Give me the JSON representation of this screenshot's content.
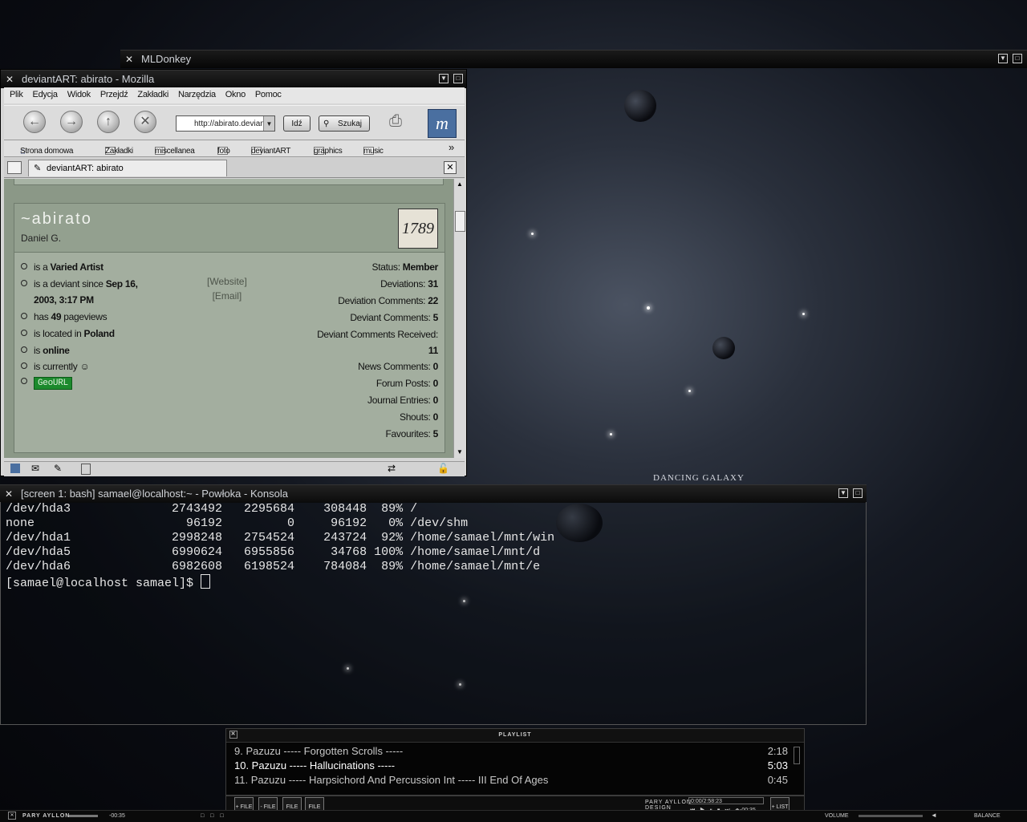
{
  "wallpaper": {
    "caption": "DANCING GALAXY"
  },
  "mldonkey": {
    "title": "MLDonkey"
  },
  "mozilla": {
    "title": "deviantART: abirato - Mozilla",
    "menu": [
      "Plik",
      "Edycja",
      "Widok",
      "Przejdź",
      "Zakładki",
      "Narzędzia",
      "Okno",
      "Pomoc"
    ],
    "url": "http://abirato.deviantart.com",
    "go_label": "Idź",
    "search_label": "Szukaj",
    "bookmarks": [
      "Strona domowa",
      "Zakładki",
      "miscellanea",
      "foto",
      "deviantART",
      "graphics",
      "music"
    ],
    "bookmarks_more": "»",
    "tab_title": "deviantART: abirato",
    "profile": {
      "username": "~abirato",
      "realname": "Daniel G.",
      "avatar_text": "1789",
      "info": [
        {
          "pre": "is a ",
          "bold": "Varied Artist",
          "post": ""
        },
        {
          "pre": "is a deviant since ",
          "bold": "Sep 16,",
          "post": ""
        },
        {
          "pre": "",
          "bold": "2003, 3:17 PM",
          "post": ""
        },
        {
          "pre": "has ",
          "bold": "49",
          "post": " pageviews"
        },
        {
          "pre": "is located in ",
          "bold": "Poland",
          "post": ""
        },
        {
          "pre": "is ",
          "bold": "online",
          "post": ""
        },
        {
          "pre": "is currently ",
          "bold": "",
          "post": ""
        }
      ],
      "geourl": "GeoURL",
      "website": "[Website]",
      "email": "[Email]",
      "stats": [
        {
          "label": "Status: ",
          "value": "Member"
        },
        {
          "label": "Deviations: ",
          "value": "31"
        },
        {
          "label": "Deviation Comments: ",
          "value": "22"
        },
        {
          "label": "Deviant Comments: ",
          "value": "5"
        },
        {
          "label": "Deviant Comments Received:",
          "value": ""
        },
        {
          "label": "",
          "value": "11"
        },
        {
          "label": "News Comments: ",
          "value": "0"
        },
        {
          "label": "Forum Posts: ",
          "value": "0"
        },
        {
          "label": "Journal Entries: ",
          "value": "0"
        },
        {
          "label": "Shouts: ",
          "value": "0"
        },
        {
          "label": "Favourites: ",
          "value": "5"
        }
      ]
    }
  },
  "terminal": {
    "title": "[screen 1: bash] samael@localhost:~ - Powłoka - Konsola",
    "lines": [
      "/dev/hda3              2743492   2295684    308448  89% /",
      "none                     96192         0     96192   0% /dev/shm",
      "/dev/hda1              2998248   2754524    243724  92% /home/samael/mnt/win",
      "/dev/hda5              6990624   6955856     34768 100% /home/samael/mnt/d",
      "/dev/hda6              6982608   6198524    784084  89% /home/samael/mnt/e"
    ],
    "prompt": "[samael@localhost samael]$ "
  },
  "xmms": {
    "playlist_title": "PLAYLIST",
    "items": [
      {
        "title": "9. Pazuzu ----- Forgotten Scrolls -----",
        "duration": "2:18"
      },
      {
        "title": "10. Pazuzu ----- Hallucinations -----",
        "duration": "5:03"
      },
      {
        "title": "11. Pazuzu ----- Harpsichord And Percussion Int ----- III End Of Ages",
        "duration": "0:45"
      }
    ],
    "buttons": [
      "+ FILE",
      "- FILE",
      "FILE",
      "FILE"
    ],
    "brand": "PARY AYLLON DESIGN",
    "time_total": "0:00/2:58:23",
    "time_remaining": "-00:35",
    "list_button": "+ LIST"
  },
  "taskbar": {
    "skin": "PARY AYLLON",
    "time": "-00:35",
    "volume_label": "VOLUME",
    "balance_label": "BALANCE"
  }
}
